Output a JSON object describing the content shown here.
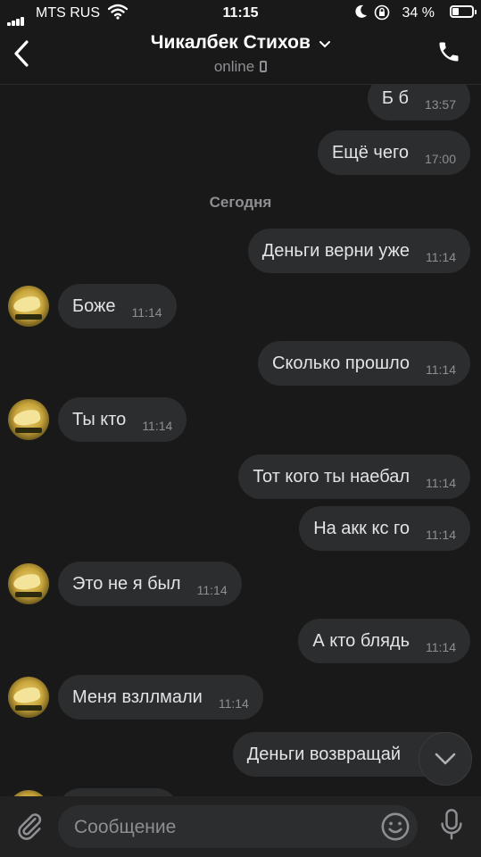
{
  "status_bar": {
    "carrier": "MTS RUS",
    "time": "11:15",
    "battery": "34 %",
    "battery_level": 0.34
  },
  "header": {
    "title": "Чикалбек Стихов",
    "subtitle": "online"
  },
  "date_separator": "Сегодня",
  "messages": [
    {
      "direction": "out",
      "text": "Б б",
      "time": "13:57"
    },
    {
      "direction": "out",
      "text": "Ещё чего",
      "time": "17:00"
    },
    {
      "direction": "out",
      "text": "Деньги верни уже",
      "time": "11:14"
    },
    {
      "direction": "in",
      "text": "Боже",
      "time": "11:14"
    },
    {
      "direction": "out",
      "text": "Сколько прошло",
      "time": "11:14"
    },
    {
      "direction": "in",
      "text": "Ты кто",
      "time": "11:14"
    },
    {
      "direction": "out",
      "text": "Тот кого ты наебал",
      "time": "11:14"
    },
    {
      "direction": "out",
      "text": "На акк кс го",
      "time": "11:14"
    },
    {
      "direction": "in",
      "text": "Это не я был",
      "time": "11:14"
    },
    {
      "direction": "out",
      "text": "А кто блядь",
      "time": "11:14"
    },
    {
      "direction": "in",
      "text": "Меня взллмали",
      "time": "11:14"
    },
    {
      "direction": "out",
      "text": "Деньги возвращай",
      "time": ""
    }
  ],
  "composer": {
    "placeholder": "Сообщение"
  },
  "icons": {
    "back": "chevron-left-icon",
    "call": "phone-icon",
    "attach": "paperclip-icon",
    "emoji": "smile-icon",
    "mic": "microphone-icon",
    "scroll_down": "chevron-down-icon"
  },
  "colors": {
    "background": "#191919",
    "bubble": "#2c2d2e",
    "text": "#e1e3e6",
    "secondary": "#8e8e93"
  }
}
